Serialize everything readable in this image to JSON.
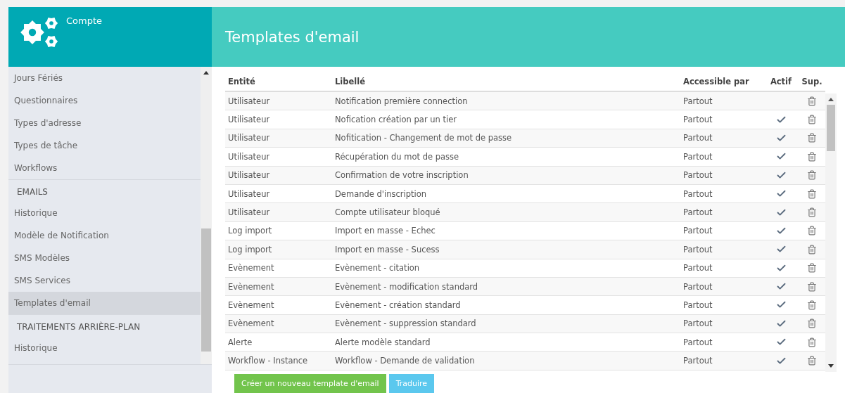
{
  "sidebar": {
    "title": "Compte",
    "sections": [
      {
        "items": [
          {
            "label": "Jours Fériés",
            "selected": false
          },
          {
            "label": "Questionnaires",
            "selected": false
          },
          {
            "label": "Types d'adresse",
            "selected": false
          },
          {
            "label": "Types de tâche",
            "selected": false
          },
          {
            "label": "Workflows",
            "selected": false
          }
        ]
      },
      {
        "heading": "EMAILS",
        "items": [
          {
            "label": "Historique",
            "selected": false
          },
          {
            "label": "Modèle de Notification",
            "selected": false
          },
          {
            "label": "SMS Modèles",
            "selected": false
          },
          {
            "label": "SMS Services",
            "selected": false
          },
          {
            "label": "Templates d'email",
            "selected": true
          }
        ]
      },
      {
        "heading": "TRAITEMENTS ARRIÈRE-PLAN",
        "items": [
          {
            "label": "Historique",
            "selected": false
          }
        ]
      }
    ]
  },
  "page": {
    "title": "Templates d'email"
  },
  "table": {
    "columns": [
      "Entité",
      "Libellé",
      "Accessible par",
      "Actif",
      "Sup."
    ],
    "rows": [
      {
        "entity": "Utilisateur",
        "label": "Notification première connection",
        "access": "Partout",
        "active": false
      },
      {
        "entity": "Utilisateur",
        "label": "Nofication création par un tier",
        "access": "Partout",
        "active": true
      },
      {
        "entity": "Utilisateur",
        "label": "Nofitication - Changement de mot de passe",
        "access": "Partout",
        "active": true
      },
      {
        "entity": "Utilisateur",
        "label": "Récupération du mot de passe",
        "access": "Partout",
        "active": true
      },
      {
        "entity": "Utilisateur",
        "label": "Confirmation de votre inscription",
        "access": "Partout",
        "active": true
      },
      {
        "entity": "Utilisateur",
        "label": "Demande d'inscription",
        "access": "Partout",
        "active": true
      },
      {
        "entity": "Utilisateur",
        "label": "Compte utilisateur bloqué",
        "access": "Partout",
        "active": true
      },
      {
        "entity": "Log import",
        "label": "Import en masse - Echec",
        "access": "Partout",
        "active": true
      },
      {
        "entity": "Log import",
        "label": "Import en masse - Sucess",
        "access": "Partout",
        "active": true
      },
      {
        "entity": "Evènement",
        "label": "Evènement - citation",
        "access": "Partout",
        "active": true
      },
      {
        "entity": "Evènement",
        "label": "Evènement - modification standard",
        "access": "Partout",
        "active": true
      },
      {
        "entity": "Evènement",
        "label": "Evènement - création standard",
        "access": "Partout",
        "active": true
      },
      {
        "entity": "Evènement",
        "label": "Evènement - suppression standard",
        "access": "Partout",
        "active": true
      },
      {
        "entity": "Alerte",
        "label": "Alerte modèle standard",
        "access": "Partout",
        "active": true
      },
      {
        "entity": "Workflow - Instance",
        "label": "Workflow - Demande de validation",
        "access": "Partout",
        "active": true
      }
    ]
  },
  "buttons": [
    {
      "label": "Créer un nouveau template d'email",
      "kind": "primary"
    },
    {
      "label": "Traduire",
      "kind": "secondary"
    }
  ]
}
